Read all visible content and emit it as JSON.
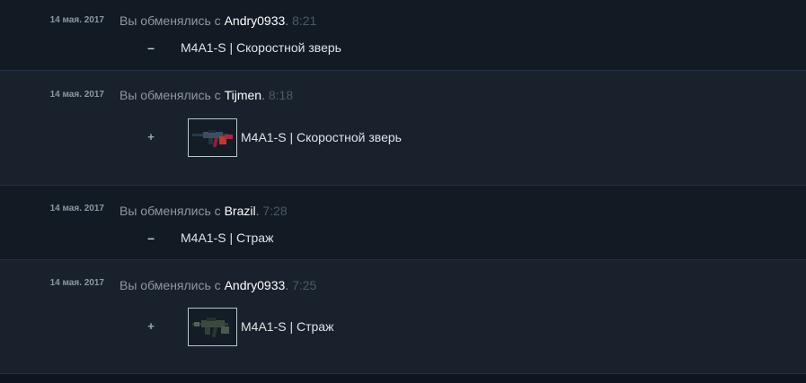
{
  "trades": [
    {
      "date": "14 мая. 2017",
      "prefix": "Вы обменялись с",
      "user": "Andry0933",
      "period": ".",
      "time": "8:21",
      "direction": "–",
      "item": "M4A1-S | Скоростной зверь",
      "thumbnail": false
    },
    {
      "date": "14 мая. 2017",
      "prefix": "Вы обменялись с",
      "user": "Tijmen",
      "period": ".",
      "time": "8:18",
      "direction": "+",
      "item": "M4A1-S | Скоростной зверь",
      "thumbnail": true,
      "thumbnail_icon": "rifle-hyper-beast-icon"
    },
    {
      "date": "14 мая. 2017",
      "prefix": "Вы обменялись с",
      "user": "Brazil",
      "period": ".",
      "time": "7:28",
      "direction": "–",
      "item": "M4A1-S | Страж",
      "thumbnail": false
    },
    {
      "date": "14 мая. 2017",
      "prefix": "Вы обменялись с",
      "user": "Andry0933",
      "period": ".",
      "time": "7:25",
      "direction": "+",
      "item": "M4A1-S | Страж",
      "thumbnail": true,
      "thumbnail_icon": "rifle-guardian-icon"
    }
  ],
  "colors": {
    "row_dark": "#121a24",
    "row_light": "#18212c",
    "username": "#ffffff",
    "description": "#8f98a0",
    "time": "#4e5966"
  }
}
